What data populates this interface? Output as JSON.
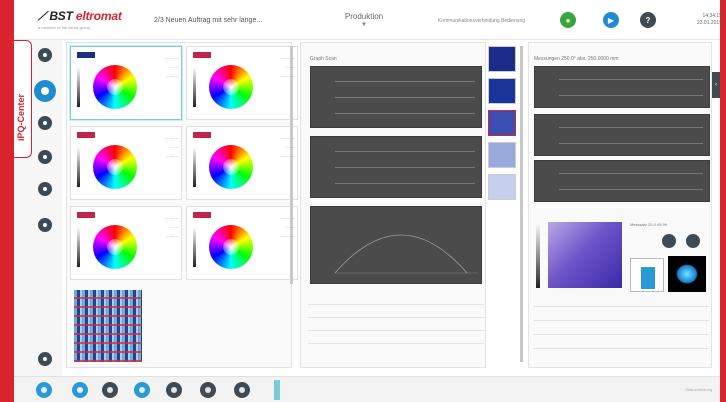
{
  "header": {
    "logo_text_black": "BST",
    "logo_text_red": "eltromat",
    "logo_sub": "a member of the elexis group",
    "order_title": "2/3 Neuen Auftrag mit sehr lange...",
    "mode": "Produktion",
    "connection_status": "Kommunikationsverbindung Bedienung",
    "time": "14:34:15",
    "date": "23.01.2019"
  },
  "sidebar": {
    "brand_label": "iPQ-Center",
    "items": [
      "monitor-icon",
      "color-wheel-icon",
      "info-icon",
      "settings-icon",
      "settings-icon",
      "power-icon",
      "save-icon"
    ]
  },
  "tiles": [
    {
      "tag": "#1c2e85"
    },
    {
      "tag": "#c0254a"
    },
    {
      "tag": "#c0254a"
    },
    {
      "tag": "#c0254a"
    },
    {
      "tag": "#c0254a"
    },
    {
      "tag": "#c0254a"
    }
  ],
  "middle_panel": {
    "title": "Graph   Scan"
  },
  "right_panel": {
    "title": "Messungen   250.0°   abs. 250.0000   mm",
    "scatter_meta": "Messsatz   20.0   49.99"
  },
  "bottombar": {
    "status": "Statusmeldung"
  },
  "colors": {
    "brand_red": "#d9232e",
    "accent_blue": "#1f8bd1",
    "green": "#3aa53c",
    "dark": "#3e4a54"
  }
}
